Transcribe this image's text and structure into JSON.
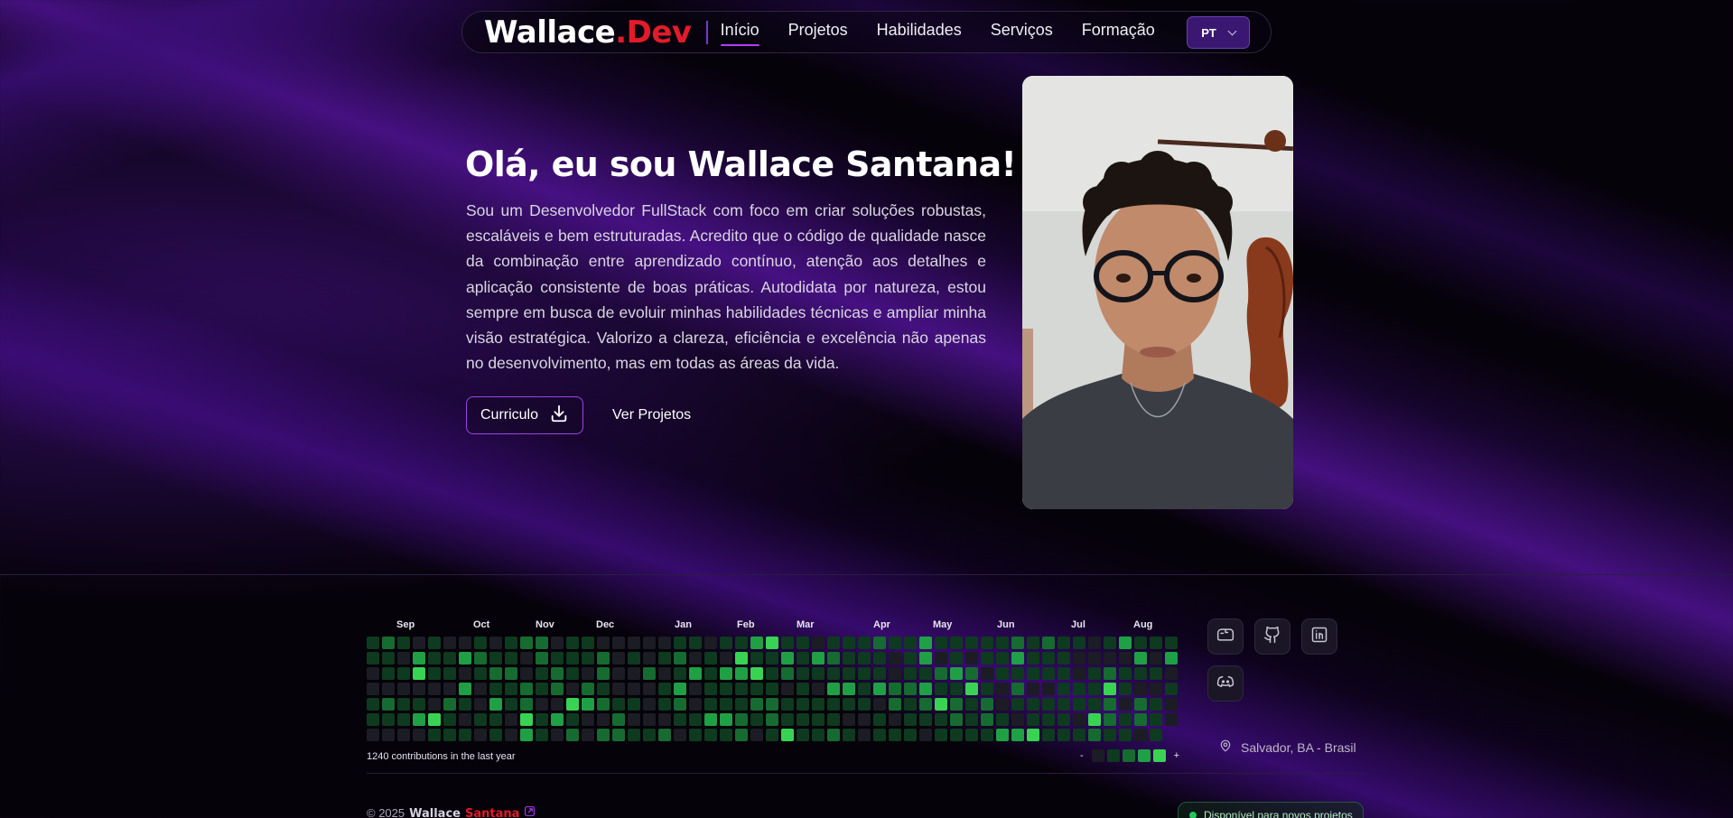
{
  "nav": {
    "logo_name": "Wallace",
    "logo_dot": ".",
    "logo_dev": "Dev",
    "links": [
      "Início",
      "Projetos",
      "Habilidades",
      "Serviços",
      "Formação"
    ],
    "language": "PT"
  },
  "hero": {
    "title": "Olá, eu sou Wallace Santana!",
    "description": "Sou um Desenvolvedor FullStack com foco em criar soluções robustas, escaláveis e bem estruturadas. Acredito que o código de qualidade nasce da combinação entre aprendizado contínuo, atenção aos detalhes e aplicação consistente de boas práticas. Autodidata por natureza, estou sempre em busca de evoluir minhas habilidades técnicas e ampliar minha visão estratégica. Valorizo a clareza, eficiência e excelência não apenas no desenvolvimento, mas em todas as áreas da vida.",
    "cv_button": "Curriculo",
    "projects_button": "Ver Projetos"
  },
  "contributions": {
    "months": [
      "Sep",
      "Oct",
      "Nov",
      "Dec",
      "Jan",
      "Feb",
      "Mar",
      "Apr",
      "May",
      "Jun",
      "Jul",
      "Aug"
    ],
    "summary": "1240 contributions in the last year",
    "legend_less": "-",
    "legend_more": "+",
    "level_colors": [
      "#1c1c24",
      "#0e3a1f",
      "#166b30",
      "#1fa045",
      "#39d353"
    ]
  },
  "footer": {
    "location": "Salvador, BA - Brasil",
    "copyright_prefix": "© 2025",
    "copyright_first": "Wallace",
    "copyright_last": "Santana",
    "status": "Disponível para novos projetos"
  },
  "icons": [
    "mailbox-icon",
    "github-icon",
    "linkedin-icon",
    "discord-icon",
    "map-pin-icon",
    "download-icon",
    "chevron-down-icon",
    "external-link-icon"
  ]
}
